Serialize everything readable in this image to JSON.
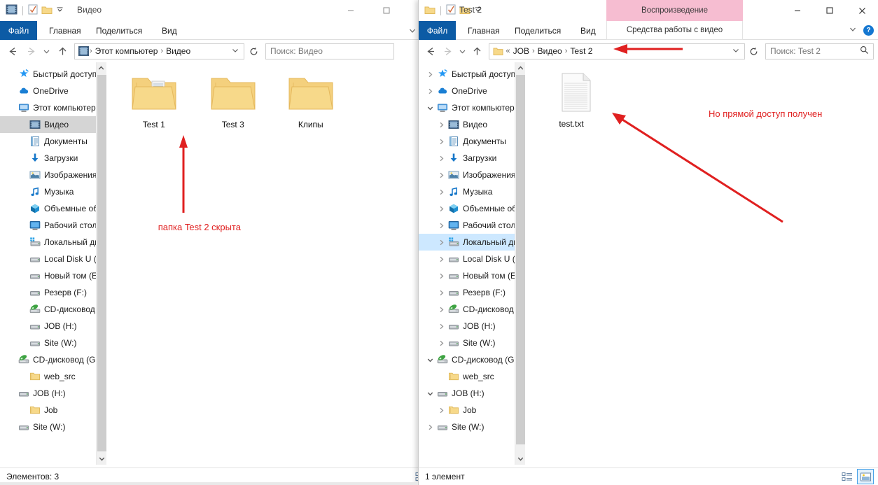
{
  "window_left": {
    "title": "Видео",
    "quick_access": [
      "video-folder-icon",
      "properties-icon",
      "new-folder-icon",
      "qat-dropdown-icon"
    ],
    "caption_buttons": [
      {
        "name": "minimize-button",
        "glyph": "—"
      },
      {
        "name": "maximize-button",
        "glyph": "▢"
      }
    ],
    "ribbon_tabs": [
      {
        "label": "Файл",
        "active": true
      },
      {
        "label": "Главная",
        "active": false
      },
      {
        "label": "Поделиться",
        "active": false
      },
      {
        "label": "Вид",
        "active": false
      }
    ],
    "address": {
      "breadcrumbs": [
        "Этот компьютер",
        "Видео"
      ],
      "search_placeholder": "Поиск: Видео"
    },
    "nav_items": [
      {
        "label": "Быстрый доступ",
        "icon": "star-icon",
        "indent": 0,
        "chevron": "",
        "selected": false
      },
      {
        "label": "OneDrive",
        "icon": "cloud-icon",
        "indent": 0,
        "chevron": "",
        "selected": false
      },
      {
        "label": "Этот компьютер",
        "icon": "computer-icon",
        "indent": 0,
        "chevron": "",
        "selected": false
      },
      {
        "label": "Видео",
        "icon": "video-icon",
        "indent": 1,
        "chevron": "",
        "selected": true
      },
      {
        "label": "Документы",
        "icon": "documents-icon",
        "indent": 1,
        "chevron": "",
        "selected": false
      },
      {
        "label": "Загрузки",
        "icon": "downloads-icon",
        "indent": 1,
        "chevron": "",
        "selected": false
      },
      {
        "label": "Изображения",
        "icon": "pictures-icon",
        "indent": 1,
        "chevron": "",
        "selected": false
      },
      {
        "label": "Музыка",
        "icon": "music-icon",
        "indent": 1,
        "chevron": "",
        "selected": false
      },
      {
        "label": "Объемные объ",
        "icon": "3d-objects-icon",
        "indent": 1,
        "chevron": "",
        "selected": false
      },
      {
        "label": "Рабочий стол",
        "icon": "desktop-icon",
        "indent": 1,
        "chevron": "",
        "selected": false
      },
      {
        "label": "Локальный дис",
        "icon": "system-drive-icon",
        "indent": 1,
        "chevron": "",
        "selected": false
      },
      {
        "label": "Local Disk U (D:)",
        "icon": "drive-icon",
        "indent": 1,
        "chevron": "",
        "selected": false
      },
      {
        "label": "Новый том (E:)",
        "icon": "drive-icon",
        "indent": 1,
        "chevron": "",
        "selected": false
      },
      {
        "label": "Резерв (F:)",
        "icon": "drive-icon",
        "indent": 1,
        "chevron": "",
        "selected": false
      },
      {
        "label": "CD-дисковод (G",
        "icon": "cd-drive-icon",
        "indent": 1,
        "chevron": "",
        "selected": false
      },
      {
        "label": "JOB (H:)",
        "icon": "drive-icon",
        "indent": 1,
        "chevron": "",
        "selected": false
      },
      {
        "label": "Site (W:)",
        "icon": "drive-icon",
        "indent": 1,
        "chevron": "",
        "selected": false
      },
      {
        "label": "CD-дисковод (G:)",
        "icon": "cd-drive-icon",
        "indent": 0,
        "chevron": "",
        "selected": false
      },
      {
        "label": "web_src",
        "icon": "folder-icon",
        "indent": 1,
        "chevron": "",
        "selected": false
      },
      {
        "label": "JOB (H:)",
        "icon": "drive-icon",
        "indent": 0,
        "chevron": "",
        "selected": false
      },
      {
        "label": "Job",
        "icon": "folder-icon",
        "indent": 1,
        "chevron": "",
        "selected": false
      },
      {
        "label": "Site (W:)",
        "icon": "drive-icon",
        "indent": 0,
        "chevron": "",
        "selected": false
      }
    ],
    "files": [
      {
        "name": "Test 1",
        "icon": "folder-with-content-icon"
      },
      {
        "name": "Test 3",
        "icon": "folder-icon"
      },
      {
        "name": "Клипы",
        "icon": "folder-icon"
      }
    ],
    "status": "Элементов: 3",
    "annotation": "папка Test 2 скрыта"
  },
  "window_right": {
    "title": "Test 2",
    "quick_access": [
      "folder-icon",
      "properties-icon",
      "new-folder-icon",
      "qat-dropdown-icon"
    ],
    "contextual_tab": "Воспроизведение",
    "contextual_tools": "Средства работы с видео",
    "contextual_color": "#f6bdd1",
    "caption_buttons": [
      {
        "name": "minimize-button",
        "glyph": "—"
      },
      {
        "name": "maximize-button",
        "glyph": "▢"
      },
      {
        "name": "close-button",
        "glyph": "✕"
      }
    ],
    "ribbon_tabs": [
      {
        "label": "Файл",
        "active": true
      },
      {
        "label": "Главная",
        "active": false
      },
      {
        "label": "Поделиться",
        "active": false
      },
      {
        "label": "Вид",
        "active": false
      }
    ],
    "ribbon_help": "?",
    "address": {
      "overflow": "«",
      "breadcrumbs": [
        "JOB",
        "Видео",
        "Test 2"
      ],
      "search_placeholder": "Поиск: Test 2"
    },
    "nav_items": [
      {
        "label": "Быстрый доступ",
        "icon": "star-icon",
        "indent": 0,
        "chevron": "collapsed",
        "selected": false
      },
      {
        "label": "OneDrive",
        "icon": "cloud-icon",
        "indent": 0,
        "chevron": "collapsed",
        "selected": false
      },
      {
        "label": "Этот компьютер",
        "icon": "computer-icon",
        "indent": 0,
        "chevron": "expanded",
        "selected": false
      },
      {
        "label": "Видео",
        "icon": "video-icon",
        "indent": 1,
        "chevron": "collapsed",
        "selected": false
      },
      {
        "label": "Документы",
        "icon": "documents-icon",
        "indent": 1,
        "chevron": "collapsed",
        "selected": false
      },
      {
        "label": "Загрузки",
        "icon": "downloads-icon",
        "indent": 1,
        "chevron": "collapsed",
        "selected": false
      },
      {
        "label": "Изображения",
        "icon": "pictures-icon",
        "indent": 1,
        "chevron": "collapsed",
        "selected": false
      },
      {
        "label": "Музыка",
        "icon": "music-icon",
        "indent": 1,
        "chevron": "collapsed",
        "selected": false
      },
      {
        "label": "Объемные объ",
        "icon": "3d-objects-icon",
        "indent": 1,
        "chevron": "collapsed",
        "selected": false
      },
      {
        "label": "Рабочий стол",
        "icon": "desktop-icon",
        "indent": 1,
        "chevron": "collapsed",
        "selected": false
      },
      {
        "label": "Локальный дис",
        "icon": "system-drive-icon",
        "indent": 1,
        "chevron": "collapsed",
        "selected": true
      },
      {
        "label": "Local Disk U (D:)",
        "icon": "drive-icon",
        "indent": 1,
        "chevron": "collapsed",
        "selected": false
      },
      {
        "label": "Новый том (E:)",
        "icon": "drive-icon",
        "indent": 1,
        "chevron": "collapsed",
        "selected": false
      },
      {
        "label": "Резерв (F:)",
        "icon": "drive-icon",
        "indent": 1,
        "chevron": "collapsed",
        "selected": false
      },
      {
        "label": "CD-дисковод (G",
        "icon": "cd-drive-icon",
        "indent": 1,
        "chevron": "collapsed",
        "selected": false
      },
      {
        "label": "JOB (H:)",
        "icon": "drive-icon",
        "indent": 1,
        "chevron": "collapsed",
        "selected": false
      },
      {
        "label": "Site (W:)",
        "icon": "drive-icon",
        "indent": 1,
        "chevron": "collapsed",
        "selected": false
      },
      {
        "label": "CD-дисковод (G:)",
        "icon": "cd-drive-icon",
        "indent": 0,
        "chevron": "expanded",
        "selected": false
      },
      {
        "label": "web_src",
        "icon": "folder-icon",
        "indent": 1,
        "chevron": "",
        "selected": false
      },
      {
        "label": "JOB (H:)",
        "icon": "drive-icon",
        "indent": 0,
        "chevron": "expanded",
        "selected": false
      },
      {
        "label": "Job",
        "icon": "folder-icon",
        "indent": 1,
        "chevron": "collapsed",
        "selected": false
      },
      {
        "label": "Site (W:)",
        "icon": "drive-icon",
        "indent": 0,
        "chevron": "collapsed",
        "selected": false
      }
    ],
    "files": [
      {
        "name": "test.txt",
        "icon": "text-file-icon"
      }
    ],
    "status": "1 элемент",
    "view_buttons": [
      {
        "name": "details-view-button",
        "active": false
      },
      {
        "name": "large-icons-view-button",
        "active": true
      }
    ],
    "annotation": "Но прямой доступ получен"
  },
  "colors": {
    "annotation_red": "#e02020",
    "file_tab_blue": "#0c5ba5",
    "selection_blue": "#cde8ff",
    "selection_gray": "#d5d5d5",
    "contextual_pink": "#f6bdd1",
    "folder_yellow": "#f5d27f"
  }
}
